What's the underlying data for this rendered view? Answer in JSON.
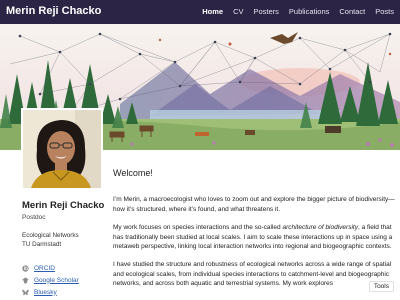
{
  "brand": "Merin Reji Chacko",
  "nav": [
    "Home",
    "CV",
    "Posters",
    "Publications",
    "Contact",
    "Posts"
  ],
  "active_nav": "Home",
  "profile": {
    "name": "Merin Reji Chacko",
    "role": "Postdoc",
    "affiliation_1": "Ecological Networks",
    "affiliation_2": "TU Darmstadt"
  },
  "links": [
    {
      "label": "ORCID",
      "icon": "orcid-icon"
    },
    {
      "label": "Google Scholar",
      "icon": "google-scholar-icon"
    },
    {
      "label": "Bluesky",
      "icon": "bluesky-icon"
    }
  ],
  "content": {
    "welcome": "Welcome!",
    "p1": "I’m Merin, a macroecologist who loves to zoom out and explore the bigger picture of biodiversity—how it’s structured, where it’s found, and what threatens it.",
    "p2a": "My work focuses on species interactions and the so-called ",
    "p2_em": "architecture of biodiversity",
    "p2b": ", a field that has traditionally been studied at local scales. I aim to scale these interactions up in space using a metaweb perspective, linking local interaction networks into regional and biogeographic contexts.",
    "p3": "I have studied the structure and robustness of ecological networks across a wide range of spatial and ecological scales, from individual species interactions to catchment-level and biogeographic networks, and across both aquatic and terrestrial systems. My work explores"
  },
  "tools_label": "Tools",
  "colors": {
    "topbar": "#2b2444",
    "link": "#2a5db0",
    "accent_sunset": "#e7a7a0"
  }
}
